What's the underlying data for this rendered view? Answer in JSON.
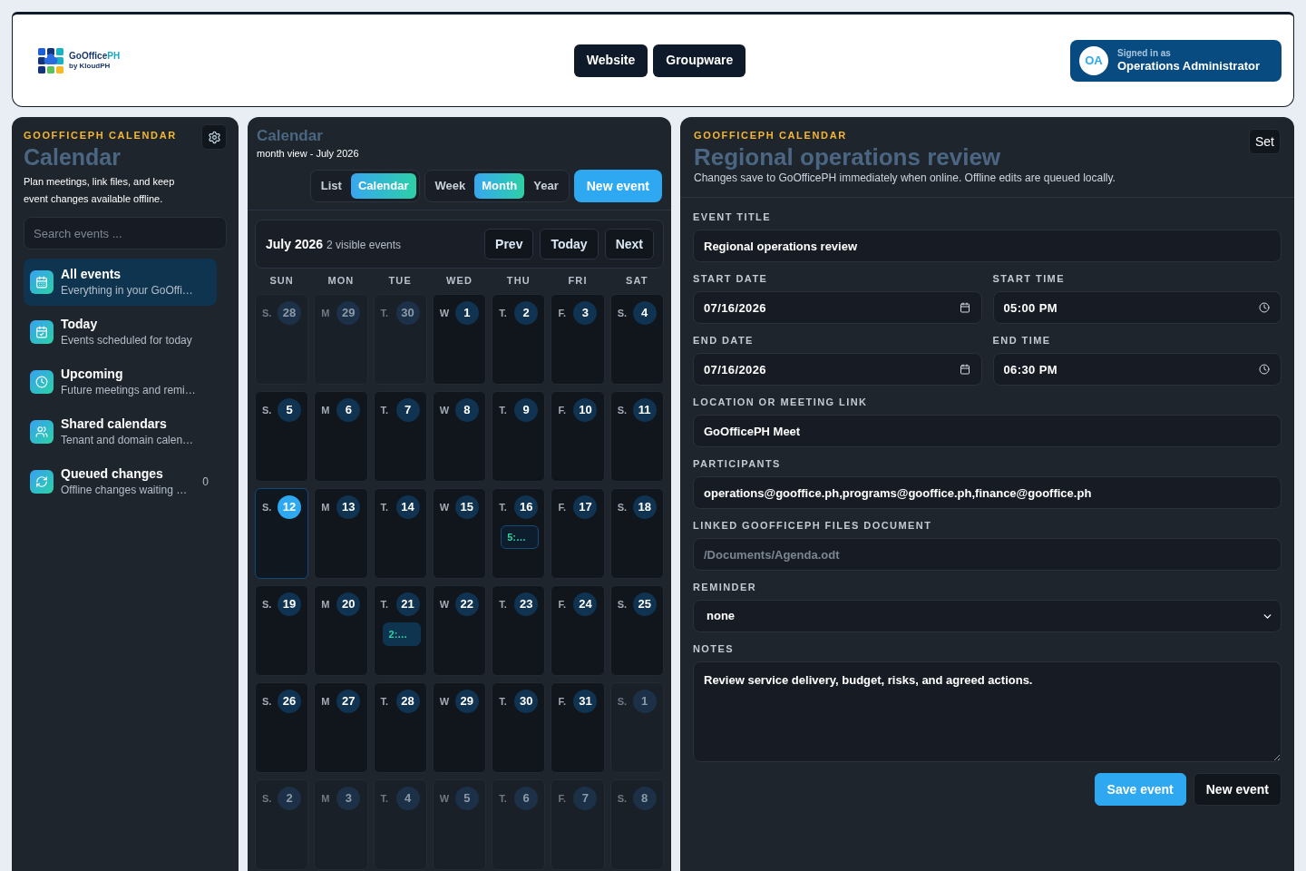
{
  "header": {
    "logo": {
      "name": "GoOffice",
      "accent": "PH",
      "tagline": "by KloudPH"
    },
    "nav": [
      {
        "label": "Website"
      },
      {
        "label": "Groupware"
      }
    ],
    "user": {
      "initials": "OA",
      "caption": "Signed in as",
      "name": "Operations Administrator"
    }
  },
  "sidebar": {
    "eyebrow": "GOOFFICEPH CALENDAR",
    "title": "Calendar",
    "description": "Plan meetings, link files, and keep event changes available offline.",
    "search": {
      "placeholder": "Search events ..."
    },
    "items": [
      {
        "kind": "all",
        "label": "All events",
        "sublabel": "Everything in your GoOffi…",
        "selected": true
      },
      {
        "kind": "today",
        "label": "Today",
        "sublabel": "Events scheduled for today",
        "selected": false
      },
      {
        "kind": "upcoming",
        "label": "Upcoming",
        "sublabel": "Future meetings and remi…",
        "selected": false
      },
      {
        "kind": "shared",
        "label": "Shared calendars",
        "sublabel": "Tenant and domain calen…",
        "selected": false
      },
      {
        "kind": "queue",
        "label": "Queued changes",
        "sublabel": "Offline changes waiting …",
        "count": "0",
        "selected": false
      }
    ]
  },
  "calendar": {
    "title": "Calendar",
    "subtitle": "month view - July 2026",
    "view_modes": [
      {
        "label": "List",
        "selected": false
      },
      {
        "label": "Calendar",
        "selected": true
      }
    ],
    "ranges": [
      {
        "label": "Week",
        "selected": false
      },
      {
        "label": "Month",
        "selected": true
      },
      {
        "label": "Year",
        "selected": false
      }
    ],
    "new_event": "New event",
    "month": {
      "label": "July 2026",
      "summary": "2 visible events",
      "nav": [
        "Prev",
        "Today",
        "Next"
      ]
    },
    "weekdays": [
      "SUN",
      "MON",
      "TUE",
      "WED",
      "THU",
      "FRI",
      "SAT"
    ],
    "weeks": [
      {
        "days": [
          {
            "prefix": "S.",
            "day": "28",
            "outside": true,
            "today": false
          },
          {
            "prefix": "M",
            "day": "29",
            "outside": true,
            "today": false
          },
          {
            "prefix": "T.",
            "day": "30",
            "outside": true,
            "today": false
          },
          {
            "prefix": "W",
            "day": "1",
            "outside": false,
            "today": false
          },
          {
            "prefix": "T.",
            "day": "2",
            "outside": false,
            "today": false
          },
          {
            "prefix": "F.",
            "day": "3",
            "outside": false,
            "today": false
          },
          {
            "prefix": "S.",
            "day": "4",
            "outside": false,
            "today": false
          }
        ]
      },
      {
        "days": [
          {
            "prefix": "S.",
            "day": "5",
            "outside": false,
            "today": false
          },
          {
            "prefix": "M",
            "day": "6",
            "outside": false,
            "today": false
          },
          {
            "prefix": "T.",
            "day": "7",
            "outside": false,
            "today": false
          },
          {
            "prefix": "W",
            "day": "8",
            "outside": false,
            "today": false
          },
          {
            "prefix": "T.",
            "day": "9",
            "outside": false,
            "today": false
          },
          {
            "prefix": "F.",
            "day": "10",
            "outside": false,
            "today": false
          },
          {
            "prefix": "S.",
            "day": "11",
            "outside": false,
            "today": false
          }
        ]
      },
      {
        "days": [
          {
            "prefix": "S.",
            "day": "12",
            "outside": false,
            "today": true
          },
          {
            "prefix": "M",
            "day": "13",
            "outside": false,
            "today": false
          },
          {
            "prefix": "T.",
            "day": "14",
            "outside": false,
            "today": false
          },
          {
            "prefix": "W",
            "day": "15",
            "outside": false,
            "today": false
          },
          {
            "prefix": "T.",
            "day": "16",
            "outside": false,
            "today": false,
            "events": [
              {
                "label": "5:…",
                "selected": true
              }
            ]
          },
          {
            "prefix": "F.",
            "day": "17",
            "outside": false,
            "today": false
          },
          {
            "prefix": "S.",
            "day": "18",
            "outside": false,
            "today": false
          }
        ]
      },
      {
        "days": [
          {
            "prefix": "S.",
            "day": "19",
            "outside": false,
            "today": false
          },
          {
            "prefix": "M",
            "day": "20",
            "outside": false,
            "today": false
          },
          {
            "prefix": "T.",
            "day": "21",
            "outside": false,
            "today": false,
            "events": [
              {
                "label": "2:…",
                "selected": false
              }
            ]
          },
          {
            "prefix": "W",
            "day": "22",
            "outside": false,
            "today": false
          },
          {
            "prefix": "T.",
            "day": "23",
            "outside": false,
            "today": false
          },
          {
            "prefix": "F.",
            "day": "24",
            "outside": false,
            "today": false
          },
          {
            "prefix": "S.",
            "day": "25",
            "outside": false,
            "today": false
          }
        ]
      },
      {
        "days": [
          {
            "prefix": "S.",
            "day": "26",
            "outside": false,
            "today": false
          },
          {
            "prefix": "M",
            "day": "27",
            "outside": false,
            "today": false
          },
          {
            "prefix": "T.",
            "day": "28",
            "outside": false,
            "today": false
          },
          {
            "prefix": "W",
            "day": "29",
            "outside": false,
            "today": false
          },
          {
            "prefix": "T.",
            "day": "30",
            "outside": false,
            "today": false
          },
          {
            "prefix": "F.",
            "day": "31",
            "outside": false,
            "today": false
          },
          {
            "prefix": "S.",
            "day": "1",
            "outside": true,
            "today": false
          }
        ]
      },
      {
        "days": [
          {
            "prefix": "S.",
            "day": "2",
            "outside": true,
            "today": false
          },
          {
            "prefix": "M",
            "day": "3",
            "outside": true,
            "today": false
          },
          {
            "prefix": "T.",
            "day": "4",
            "outside": true,
            "today": false
          },
          {
            "prefix": "W",
            "day": "5",
            "outside": true,
            "today": false
          },
          {
            "prefix": "T.",
            "day": "6",
            "outside": true,
            "today": false
          },
          {
            "prefix": "F.",
            "day": "7",
            "outside": true,
            "today": false
          },
          {
            "prefix": "S.",
            "day": "8",
            "outside": true,
            "today": false
          }
        ]
      }
    ]
  },
  "editor": {
    "eyebrow": "GOOFFICEPH CALENDAR",
    "title": "Regional operations review",
    "description": "Changes save to GoOfficePH immediately when online. Offline edits are queued locally.",
    "corner_button": "Set",
    "rows": [
      [
        {
          "kind": "text",
          "label": "EVENT TITLE",
          "value": "Regional operations review"
        }
      ],
      [
        {
          "kind": "date",
          "label": "START DATE",
          "value": "07/16/2026"
        },
        {
          "kind": "time",
          "label": "START TIME",
          "value": "05:00 PM"
        }
      ],
      [
        {
          "kind": "date",
          "label": "END DATE",
          "value": "07/16/2026"
        },
        {
          "kind": "time",
          "label": "END TIME",
          "value": "06:30 PM"
        }
      ],
      [
        {
          "kind": "text",
          "label": "LOCATION OR MEETING LINK",
          "value": "GoOfficePH Meet"
        }
      ],
      [
        {
          "kind": "text",
          "label": "PARTICIPANTS",
          "value": "operations@gooffice.ph,programs@gooffice.ph,finance@gooffice.ph"
        }
      ],
      [
        {
          "kind": "text",
          "label": "LINKED GOOFFICEPH FILES DOCUMENT",
          "placeholder": "/Documents/Agenda.odt"
        }
      ],
      [
        {
          "kind": "select",
          "label": "REMINDER",
          "value": "none"
        }
      ],
      [
        {
          "kind": "textarea",
          "label": "NOTES",
          "value": "Review service delivery, budget, risks, and agreed actions."
        }
      ]
    ],
    "actions": [
      {
        "kind": "primary",
        "label": "Save event"
      },
      {
        "kind": "secondary",
        "label": "New event"
      }
    ]
  }
}
